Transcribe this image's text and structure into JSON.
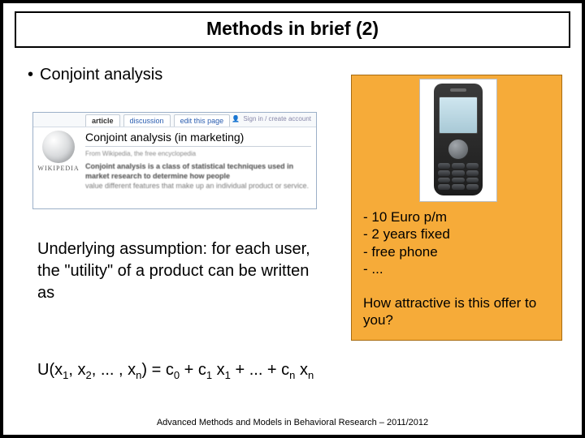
{
  "title": "Methods in brief (2)",
  "bullet": "Conjoint analysis",
  "wiki": {
    "tabs": {
      "article": "article",
      "discussion": "discussion",
      "edit": "edit this page"
    },
    "right": {
      "signin": "Sign in / create account"
    },
    "brand": "WIKIPEDIA",
    "heading": "Conjoint analysis (in marketing)",
    "sub": "From Wikipedia, the free encyclopedia",
    "para1": "Conjoint analysis is a class of statistical techniques used in market research to determine how people",
    "para2": "value different features that make up an individual product or service."
  },
  "assumption": "Underlying assumption: for each user, the \"utility\" of a product can be written as",
  "equation": {
    "lhs1": "U(x",
    "s1": "1",
    "c1": ", x",
    "s2": "2",
    "c2": ", ... , x",
    "sn": "n",
    "mid": ") = c",
    "z0": "0",
    "p1": " + c",
    "z1": "1",
    "p2": " x",
    "z1b": "1",
    "dots": " + ... + c",
    "znc": "n",
    "p3": " x",
    "znx": "n"
  },
  "offer": {
    "line1": "10 Euro p/m",
    "line2": "2 years fixed",
    "line3": "free phone",
    "line4": "..."
  },
  "question": "How attractive is this offer to you?",
  "footer": "Advanced Methods and Models in Behavioral Research – 2011/2012"
}
